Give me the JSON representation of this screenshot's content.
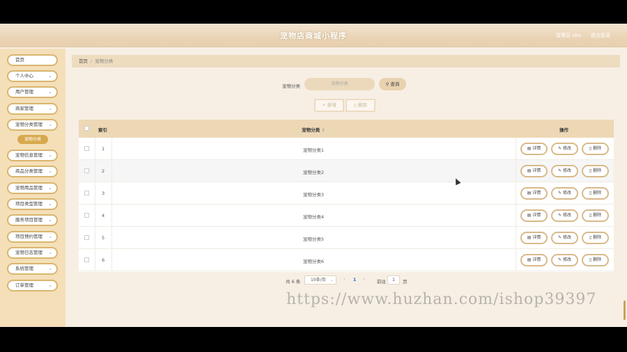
{
  "header": {
    "title": "宠物店商城小程序",
    "user": "管理员 abo",
    "logout": "退出登录"
  },
  "sidebar": {
    "items": [
      {
        "label": "首页",
        "chevron": false
      },
      {
        "label": "个人中心",
        "chevron": true
      },
      {
        "label": "用户管理",
        "chevron": true
      },
      {
        "label": "商家管理",
        "chevron": true
      },
      {
        "label": "宠物分类管理",
        "chevron": true
      },
      {
        "label": "宠物信息管理",
        "chevron": true
      },
      {
        "label": "商品分类管理",
        "chevron": true
      },
      {
        "label": "宠物用品管理",
        "chevron": true
      },
      {
        "label": "项目类型管理",
        "chevron": true
      },
      {
        "label": "服务项目管理",
        "chevron": true
      },
      {
        "label": "项目预约管理",
        "chevron": true
      },
      {
        "label": "宠物日志管理",
        "chevron": true
      },
      {
        "label": "系统管理",
        "chevron": true
      },
      {
        "label": "订单管理",
        "chevron": true
      }
    ],
    "active_sub": "宠物分类"
  },
  "breadcrumb": {
    "home": "首页",
    "sep": "/",
    "current": "宠物分类"
  },
  "search": {
    "label": "宠物分类",
    "placeholder": "宠物分类",
    "button": "查询"
  },
  "actions": {
    "add": "新增",
    "delete": "删除"
  },
  "table": {
    "headers": {
      "index": "索引",
      "name": "宠物分类",
      "ops": "操作"
    },
    "rows": [
      {
        "index": "1",
        "name": "宠物分类1"
      },
      {
        "index": "2",
        "name": "宠物分类2"
      },
      {
        "index": "3",
        "name": "宠物分类3"
      },
      {
        "index": "4",
        "name": "宠物分类4"
      },
      {
        "index": "5",
        "name": "宠物分类5"
      },
      {
        "index": "6",
        "name": "宠物分类6"
      }
    ],
    "ops": {
      "detail": "详情",
      "edit": "修改",
      "delete": "删除"
    }
  },
  "pager": {
    "total": "共 6 条",
    "size": "10条/页",
    "page": "1",
    "goto": "前往",
    "goto_value": "1",
    "unit": "页"
  },
  "watermark": "https://www.huzhan.com/ishop39397",
  "colors": {
    "accent": "#d7a94e",
    "header": "#edd8b6"
  }
}
